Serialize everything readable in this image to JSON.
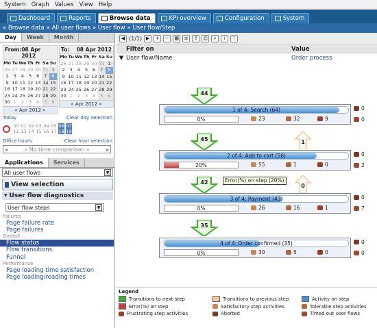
{
  "menu": [
    "System",
    "Graph",
    "Values",
    "View",
    "Help"
  ],
  "tabs": [
    {
      "label": "Dashboard",
      "active": false
    },
    {
      "label": "Reports",
      "active": false
    },
    {
      "label": "Browse data",
      "active": true
    },
    {
      "label": "KPI overview",
      "active": false
    },
    {
      "label": "Configuration",
      "active": false
    },
    {
      "label": "System",
      "active": false
    }
  ],
  "breadcrumbs": [
    "» Browse data",
    "» All user flows",
    "» User flow",
    "» User flow/Step"
  ],
  "left": {
    "subtabs": [
      "Day",
      "Week",
      "Month"
    ],
    "from": {
      "label": "From:",
      "date": "08 Apr 2012",
      "month": "« Apr 2012 »"
    },
    "to": {
      "label": "To:",
      "date": "08 Apr 2012",
      "month": "« Apr 2012 »"
    },
    "weekdays": [
      "Mo",
      "Tu",
      "We",
      "Th",
      "Fr",
      "Sa",
      "Su"
    ],
    "cal_from": [
      [
        "26",
        "27",
        "28",
        "29",
        "30",
        "31",
        "1"
      ],
      [
        "2",
        "3",
        "4",
        "5",
        "6",
        "7",
        "8"
      ],
      [
        "9",
        "10",
        "11",
        "12",
        "13",
        "14",
        "15"
      ],
      [
        "16",
        "17",
        "18",
        "19",
        "20",
        "21",
        "22"
      ],
      [
        "23",
        "24",
        "25",
        "26",
        "27",
        "28",
        "29"
      ],
      [
        "30",
        "1",
        "2",
        "3",
        "4",
        "5",
        "6"
      ]
    ],
    "cal_to": [
      [
        "26",
        "27",
        "28",
        "29",
        "30",
        "31",
        "1"
      ],
      [
        "2",
        "3",
        "4",
        "5",
        "6",
        "7",
        "8"
      ],
      [
        "9",
        "10",
        "11",
        "12",
        "13",
        "14",
        "15"
      ],
      [
        "16",
        "17",
        "18",
        "19",
        "20",
        "21",
        "22"
      ],
      [
        "23",
        "24",
        "25",
        "26",
        "27",
        "28",
        "29"
      ],
      [
        "30",
        "1",
        "2",
        "3",
        "4",
        "5",
        "6"
      ]
    ],
    "today": "Today",
    "clear_day": "Clear day selection",
    "hours_row1": [
      "00",
      "01",
      "02",
      "03",
      "04",
      "05",
      "06",
      "07"
    ],
    "hours_row2": [
      "12",
      "13",
      "14",
      "15",
      "16",
      "17",
      "18",
      "19"
    ],
    "office_hours": "Office hours",
    "clear_hour": "Clear hour selection",
    "no_comparison": "« No time comparison »",
    "app_tabs": [
      "Applications",
      "Services"
    ],
    "flows_select": "All user flows",
    "view_selection": "View selection",
    "diag_title": "User flow diagnostics",
    "steps_select": "User flow steps",
    "nav": [
      {
        "type": "grp",
        "label": "Failures"
      },
      {
        "type": "item",
        "label": "Page failure rate"
      },
      {
        "type": "item",
        "label": "Page failures"
      },
      {
        "type": "grp",
        "label": "Overall"
      },
      {
        "type": "cur",
        "label": "Flow status"
      },
      {
        "type": "item",
        "label": "Flow transitions"
      },
      {
        "type": "item",
        "label": "Funnel"
      },
      {
        "type": "grp",
        "label": "Performance"
      },
      {
        "type": "item",
        "label": "Page loading time satisfaction"
      },
      {
        "type": "item",
        "label": "Page loading/reading times"
      }
    ]
  },
  "toolbar": {
    "pager": "(1/1)"
  },
  "filter": {
    "col1": "Filter on",
    "col2": "Value",
    "key": "User flow/Name",
    "value": "Order process"
  },
  "flow": {
    "steps": [
      {
        "title": "1 of 4: Search (64)",
        "activity": 95,
        "error": "0%",
        "err_frac": 0,
        "sat": "23",
        "tol": "32",
        "frus": "9",
        "abort": "0",
        "timeout": "0"
      },
      {
        "title": "2 of 4: Add to cart (56)",
        "activity": 83,
        "error": "20%",
        "err_frac": 0.2,
        "sat": "55",
        "tol": "1",
        "frus": "0",
        "abort": "0",
        "timeout": "2"
      },
      {
        "title": "3 of 4: Payment (43)",
        "activity": 64,
        "error": "0%",
        "err_frac": 0,
        "sat": "26",
        "tol": "16",
        "frus": "1",
        "abort": "0",
        "timeout": "7"
      },
      {
        "title": "4 of 4: Order confirmed (35)",
        "activity": 52,
        "error": "0%",
        "err_frac": 0,
        "sat": "30",
        "tol": "5",
        "frus": "0",
        "abort": "0",
        "timeout": "0"
      }
    ],
    "next": [
      "44",
      "45",
      "42",
      "35"
    ],
    "prev": [
      "1",
      "0"
    ],
    "tooltip": "Error(%) on step (20%)"
  },
  "legend": {
    "title": "Legend",
    "items": [
      "Transitions to next step",
      "Transitions to previous step",
      "Activity on step",
      "Error(%) on step",
      "Satisfactory step activities",
      "Tolerable step activities",
      "Frustrating step activities",
      "Aborted",
      "Timed out user flows"
    ]
  },
  "colors": {
    "next": "#3dae2b",
    "prev": "#f5c98f",
    "activity": "#4a90d9",
    "error": "#c94040",
    "tab_bar": "#1c5a8e"
  }
}
